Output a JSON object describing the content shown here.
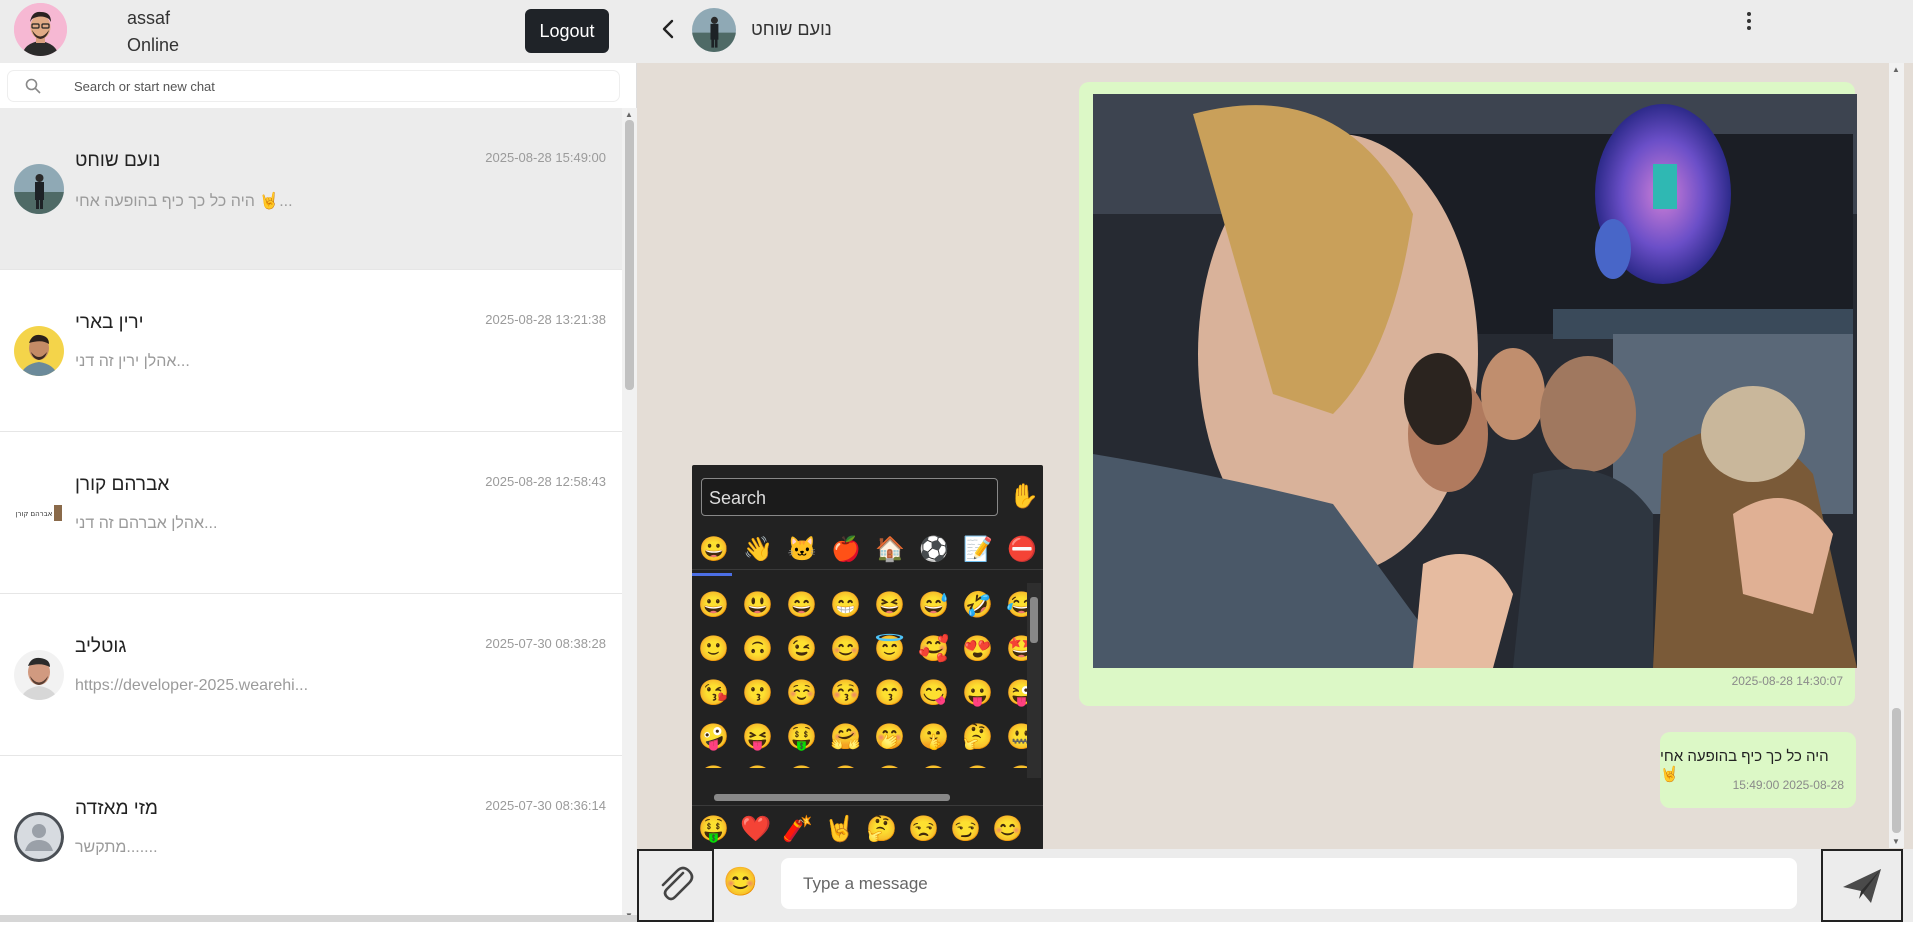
{
  "me": {
    "name": "assaf",
    "status": "Online"
  },
  "header": {
    "logout_label": "Logout"
  },
  "search": {
    "placeholder": "Search or start new chat"
  },
  "chats": [
    {
      "name": "נועם שוחט",
      "preview": "היה כל כך כיף בהופעה אחי 🤘...",
      "time": "2025-08-28 15:49:00"
    },
    {
      "name": "ירין בארי",
      "preview": "אהלן ירין זה דני...",
      "time": "2025-08-28 13:21:38"
    },
    {
      "name": "אברהם קורן",
      "preview": "אהלן אברהם זה דני...",
      "time": "2025-08-28 12:58:43"
    },
    {
      "name": "גוטליב",
      "preview": "https://developer-2025.wearehi...",
      "time": "2025-07-30 08:38:28"
    },
    {
      "name": "מזי מאזדה",
      "preview": "מתקשר.......",
      "time": "2025-07-30 08:36:14"
    }
  ],
  "avatar_logo_text": "אברהם קורן",
  "conversation": {
    "contact_name": "נועם שוחט",
    "messages": [
      {
        "type": "image",
        "time": "2025-08-28 14:30:07"
      },
      {
        "type": "text",
        "text": "היה כל כך כיף בהופעה אחי 🤘",
        "time": "15:49:00 2025-08-28"
      }
    ]
  },
  "emoji_picker": {
    "search_placeholder": "Search",
    "skin_tone": "✋",
    "categories": [
      "😀",
      "👋",
      "🐱",
      "🍎",
      "🏠",
      "⚽",
      "📝",
      "⛔"
    ],
    "grid": [
      [
        "😀",
        "😃",
        "😄",
        "😁",
        "😆",
        "😅",
        "🤣",
        "😂"
      ],
      [
        "🙂",
        "🙃",
        "😉",
        "😊",
        "😇",
        "🥰",
        "😍",
        "🤩"
      ],
      [
        "😘",
        "😗",
        "☺️",
        "😚",
        "😙",
        "😋",
        "😛",
        "😜"
      ],
      [
        "🤪",
        "😝",
        "🤑",
        "🤗",
        "🤭",
        "🤫",
        "🤔",
        "🤐"
      ],
      [
        "🤨",
        "😐",
        "😑",
        "😶",
        "😏",
        "😒",
        "🙄",
        "😬"
      ]
    ],
    "recent": [
      "🤑",
      "❤️",
      "🧨",
      "🤘",
      "🤔",
      "😒",
      "😏",
      "😊"
    ]
  },
  "composer": {
    "placeholder": "Type a message",
    "emoji_icon": "😊"
  },
  "colors": {
    "bubble": "#dcf8c6",
    "chat_bg": "#e4ddd6",
    "header": "#ececec",
    "picker_accent": "#4c6fe5"
  }
}
